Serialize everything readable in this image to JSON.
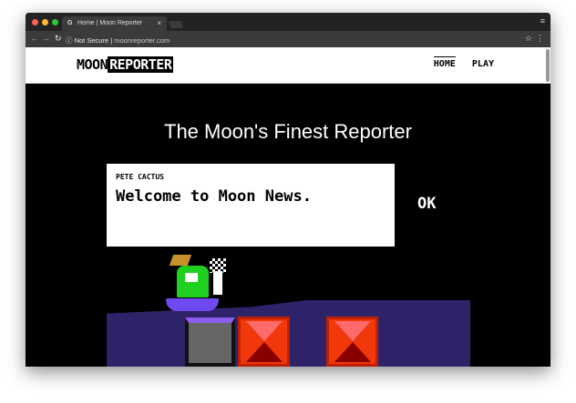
{
  "browser": {
    "tab_title": "Home | Moon Reporter",
    "url_security": "Not Secure",
    "url": "moonreporter.com"
  },
  "nav": {
    "logo_part1": "MOON",
    "logo_part2": "REPORTER",
    "links": [
      {
        "label": "HOME",
        "active": true
      },
      {
        "label": "PLAY",
        "active": false
      }
    ]
  },
  "hero": {
    "title": "The Moon's Finest Reporter"
  },
  "dialog": {
    "speaker": "PETE CACTUS",
    "message": "Welcome to Moon News.",
    "ok_label": "OK"
  }
}
